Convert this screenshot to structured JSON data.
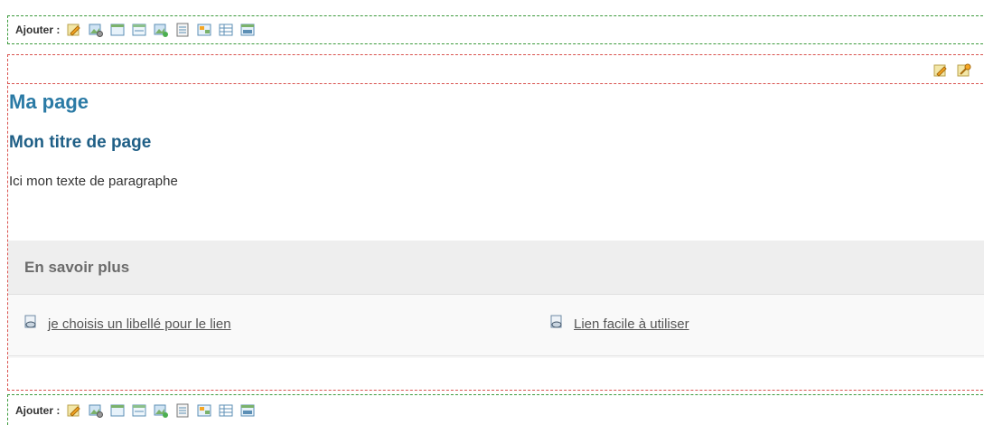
{
  "add_bar": {
    "label": "Ajouter :",
    "icons": [
      "edit-text-icon",
      "image-settings-icon",
      "layout-block-icon",
      "window-block-icon",
      "image-add-icon",
      "list-block-icon",
      "gallery-icon",
      "table-block-icon",
      "html-block-icon"
    ]
  },
  "block_tools": {
    "icons": [
      "edit-pencil-icon",
      "edit-settings-icon"
    ]
  },
  "content": {
    "page_title": "Ma page",
    "section_title": "Mon titre de page",
    "paragraph": "Ici mon texte de paragraphe"
  },
  "more_section": {
    "header": "En savoir plus",
    "links": [
      {
        "label": "je choisis un libellé pour le lien",
        "icon": "link-document-icon"
      },
      {
        "label": "Lien facile à utiliser",
        "icon": "link-document-icon"
      }
    ]
  },
  "colors": {
    "green_dashed": "#3c9a3c",
    "red_dashed": "#d9534f",
    "title_blue": "#2a7aa5",
    "subtitle_blue": "#1f5f86"
  }
}
